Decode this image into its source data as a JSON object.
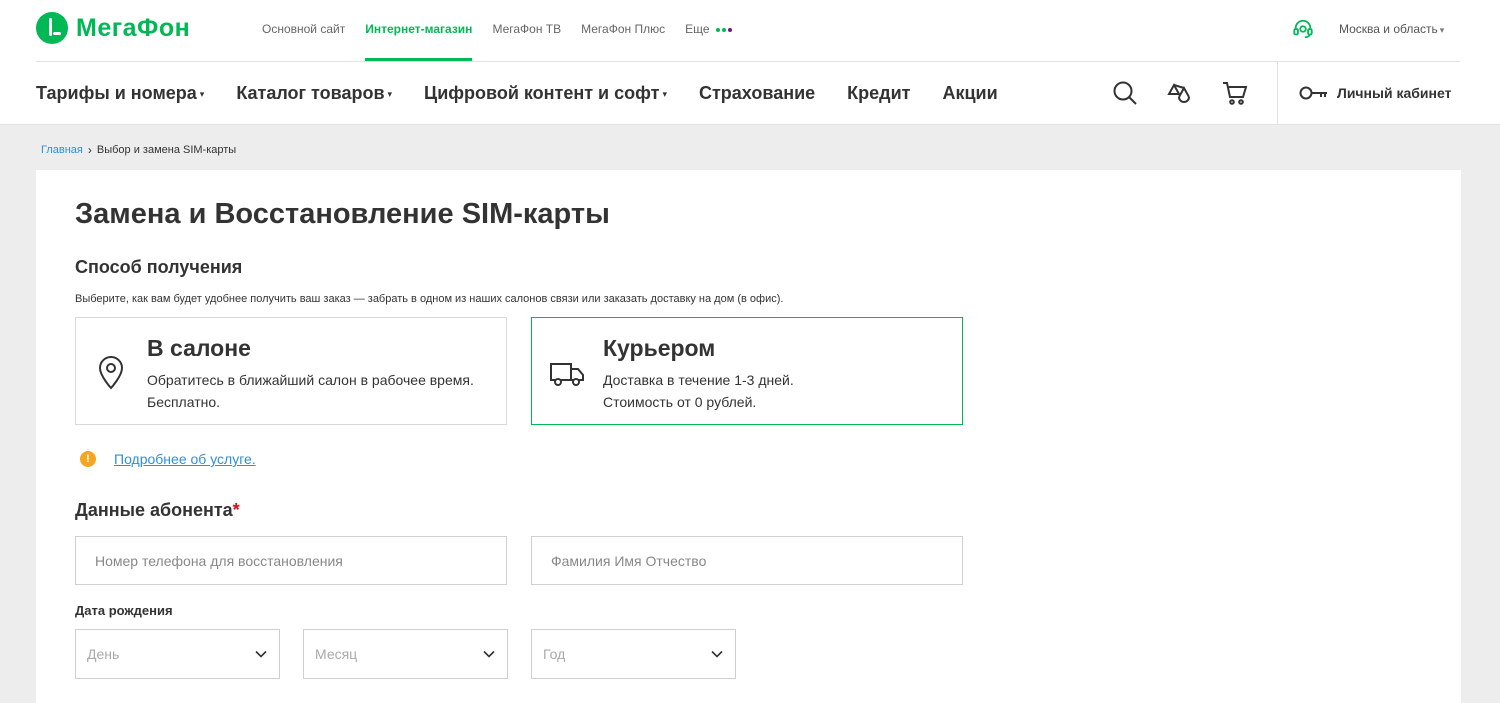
{
  "brand": {
    "logo_text": "МегаФон",
    "green": "#00b956",
    "link_blue": "#2f8fd8",
    "warn_orange": "#f5a623"
  },
  "subnav": {
    "items": [
      {
        "label": "Основной сайт"
      },
      {
        "label": "Интернет-магазин",
        "active": true
      },
      {
        "label": "МегаФон ТВ"
      },
      {
        "label": "МегаФон Плюс"
      },
      {
        "label": "Еще"
      }
    ],
    "more_dot_colors": [
      "#00b956",
      "#00b956",
      "#731982"
    ]
  },
  "region": {
    "label": "Москва и область"
  },
  "mainnav": {
    "items": [
      {
        "label": "Тарифы и номера",
        "has_dropdown": true
      },
      {
        "label": "Каталог товаров",
        "has_dropdown": true
      },
      {
        "label": "Цифровой контент и софт",
        "has_dropdown": true
      },
      {
        "label": "Страхование"
      },
      {
        "label": "Кредит"
      },
      {
        "label": "Акции"
      }
    ],
    "icons": [
      "search-icon",
      "compare-icon",
      "cart-icon"
    ],
    "cabinet_label": "Личный кабинет"
  },
  "breadcrumb": {
    "home": "Главная",
    "current": "Выбор и замена SIM-карты"
  },
  "page": {
    "title": "Замена и Восстановление SIM-карты",
    "delivery_section": "Способ получения",
    "delivery_hint": "Выберите, как вам будет удобнее получить ваш заказ — забрать в одном из наших салонов связи или заказать доставку на дом (в офис).",
    "options": [
      {
        "title": "В салоне",
        "desc": "Обратитесь в ближайший салон в рабочее время. Бесплатно.",
        "icon": "location-pin-icon",
        "selected": false
      },
      {
        "title": "Курьером",
        "desc_line1": "Доставка в течение 1-3 дней.",
        "desc_line2": "Стоимость от 0 рублей.",
        "icon": "delivery-truck-icon",
        "selected": true
      }
    ],
    "info_link": "Подробнее об услуге.",
    "subscriber_section": "Данные абонента",
    "required_mark": "*",
    "phone_placeholder": "Номер телефона для восстановления",
    "name_placeholder": "Фамилия Имя Отчество",
    "dob_label": "Дата рождения",
    "dob_selects": [
      "День",
      "Месяц",
      "Год"
    ]
  }
}
